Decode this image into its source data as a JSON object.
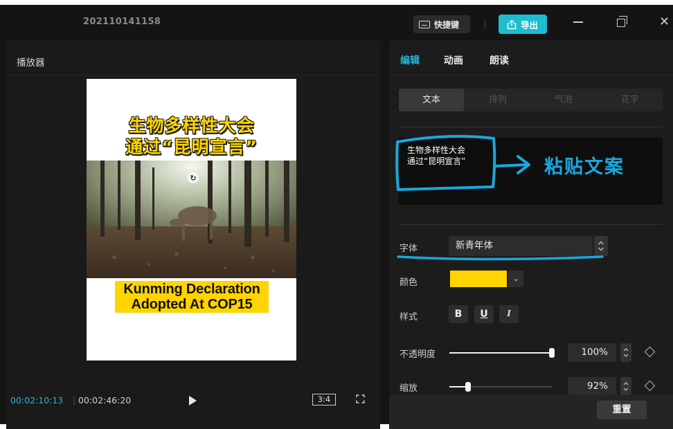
{
  "window": {
    "project_title": "202110141158",
    "shortcut_label": "快捷键",
    "export_label": "导出"
  },
  "player": {
    "title": "播放器",
    "video": {
      "headline_line1": "生物多样性大会",
      "headline_line2": "通过“昆明宣言”",
      "caption_line1": "Kunming Declaration",
      "caption_line2": "Adopted At COP15"
    },
    "time_current": "00:02:10:13",
    "time_separator": "|",
    "time_total": "00:02:46:20",
    "aspect_ratio": "3:4"
  },
  "editor": {
    "tabs": [
      {
        "label": "编辑",
        "active": true
      },
      {
        "label": "动画",
        "active": false
      },
      {
        "label": "朗读",
        "active": false
      }
    ],
    "subtabs": [
      {
        "label": "文本",
        "active": true
      },
      {
        "label": "排列",
        "active": false
      },
      {
        "label": "气泡",
        "active": false
      },
      {
        "label": "花字",
        "active": false
      }
    ],
    "text_content": "生物多样性大会\n通过“昆明宣言”",
    "annotation": "粘贴文案",
    "font_label": "字体",
    "font_value": "新青年体",
    "color_label": "颜色",
    "color_value": "#ffd400",
    "style_label": "样式",
    "style_buttons": [
      "B",
      "U",
      "I"
    ],
    "opacity_label": "不透明度",
    "opacity_value": "100%",
    "opacity_fraction": 1.0,
    "scale_label": "缩放",
    "scale_value": "92%",
    "reset_label": "重置"
  },
  "colors": {
    "accent": "#27b6d6",
    "export_button": "#1fbccf",
    "annotation": "#18a8e0",
    "subtitle_yellow": "#ffd400"
  }
}
